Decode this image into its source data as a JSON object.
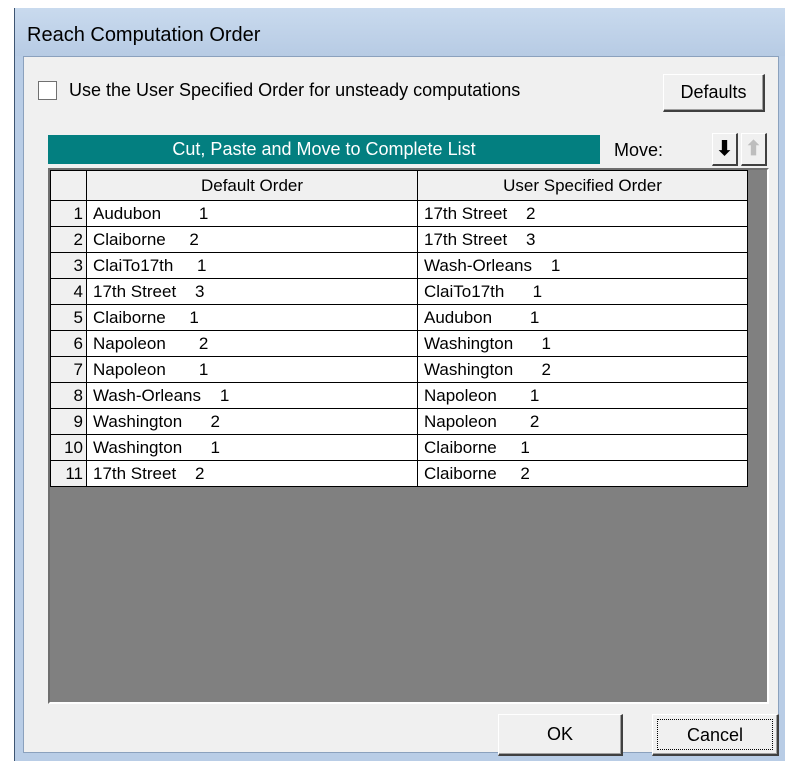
{
  "window": {
    "title": "Reach Computation Order"
  },
  "options": {
    "use_user_order_label": "Use the User Specified Order for unsteady computations",
    "use_user_order_checked": false,
    "defaults_label": "Defaults"
  },
  "banner": {
    "text": "Cut, Paste and Move to Complete List"
  },
  "move": {
    "label": "Move:",
    "down_icon": "arrow-down-icon",
    "up_icon": "arrow-up-icon"
  },
  "grid": {
    "columns": [
      "",
      "Default Order",
      "User Specified Order"
    ],
    "rows": [
      {
        "n": "1",
        "default": "Audubon        1",
        "user": "17th Street    2"
      },
      {
        "n": "2",
        "default": "Claiborne     2",
        "user": "17th Street    3"
      },
      {
        "n": "3",
        "default": "ClaiTo17th     1",
        "user": "Wash-Orleans    1"
      },
      {
        "n": "4",
        "default": "17th Street    3",
        "user": "ClaiTo17th      1"
      },
      {
        "n": "5",
        "default": "Claiborne     1",
        "user": "Audubon        1"
      },
      {
        "n": "6",
        "default": "Napoleon       2",
        "user": "Washington      1"
      },
      {
        "n": "7",
        "default": "Napoleon       1",
        "user": "Washington      2"
      },
      {
        "n": "8",
        "default": "Wash-Orleans    1",
        "user": "Napoleon       1"
      },
      {
        "n": "9",
        "default": "Washington      2",
        "user": "Napoleon       2"
      },
      {
        "n": "10",
        "default": "Washington      1",
        "user": "Claiborne     1"
      },
      {
        "n": "11",
        "default": "17th Street    2",
        "user": "Claiborne     2"
      }
    ]
  },
  "footer": {
    "ok_label": "OK",
    "cancel_label": "Cancel"
  }
}
